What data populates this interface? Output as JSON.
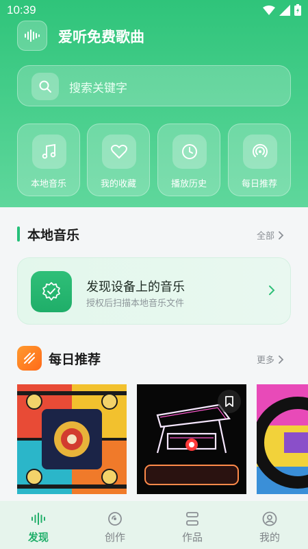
{
  "status_bar": {
    "time": "10:39"
  },
  "app": {
    "title": "爱听免费歌曲"
  },
  "search": {
    "placeholder": "搜索关键字"
  },
  "quick_actions": [
    {
      "label": "本地音乐",
      "icon": "music-note-icon"
    },
    {
      "label": "我的收藏",
      "icon": "heart-icon"
    },
    {
      "label": "播放历史",
      "icon": "clock-icon"
    },
    {
      "label": "每日推荐",
      "icon": "radio-icon"
    }
  ],
  "local_music": {
    "title": "本地音乐",
    "more_label": "全部",
    "discover_title": "发现设备上的音乐",
    "discover_subtitle": "授权后扫描本地音乐文件"
  },
  "daily": {
    "title": "每日推荐",
    "more_label": "更多"
  },
  "bottom_nav": [
    {
      "label": "发现",
      "icon": "waveform-icon",
      "active": true
    },
    {
      "label": "创作",
      "icon": "disc-icon",
      "active": false
    },
    {
      "label": "作品",
      "icon": "list-icon",
      "active": false
    },
    {
      "label": "我的",
      "icon": "person-icon",
      "active": false
    }
  ],
  "colors": {
    "accent": "#1fae69",
    "header": "#2fc47a",
    "daily_badge": "#ff7a1f"
  }
}
